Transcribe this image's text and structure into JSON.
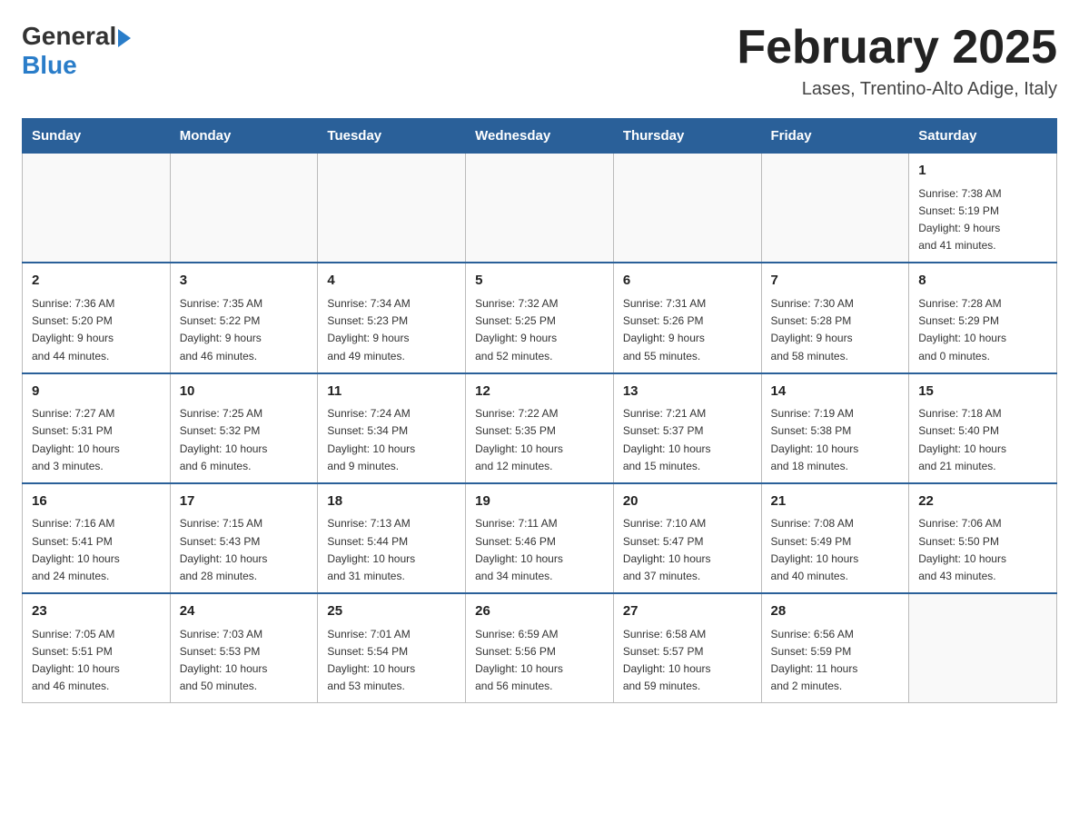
{
  "header": {
    "logo": {
      "general": "General",
      "blue": "Blue"
    },
    "title": "February 2025",
    "subtitle": "Lases, Trentino-Alto Adige, Italy"
  },
  "days_of_week": [
    "Sunday",
    "Monday",
    "Tuesday",
    "Wednesday",
    "Thursday",
    "Friday",
    "Saturday"
  ],
  "weeks": [
    {
      "days": [
        {
          "number": "",
          "info": ""
        },
        {
          "number": "",
          "info": ""
        },
        {
          "number": "",
          "info": ""
        },
        {
          "number": "",
          "info": ""
        },
        {
          "number": "",
          "info": ""
        },
        {
          "number": "",
          "info": ""
        },
        {
          "number": "1",
          "info": "Sunrise: 7:38 AM\nSunset: 5:19 PM\nDaylight: 9 hours\nand 41 minutes."
        }
      ]
    },
    {
      "days": [
        {
          "number": "2",
          "info": "Sunrise: 7:36 AM\nSunset: 5:20 PM\nDaylight: 9 hours\nand 44 minutes."
        },
        {
          "number": "3",
          "info": "Sunrise: 7:35 AM\nSunset: 5:22 PM\nDaylight: 9 hours\nand 46 minutes."
        },
        {
          "number": "4",
          "info": "Sunrise: 7:34 AM\nSunset: 5:23 PM\nDaylight: 9 hours\nand 49 minutes."
        },
        {
          "number": "5",
          "info": "Sunrise: 7:32 AM\nSunset: 5:25 PM\nDaylight: 9 hours\nand 52 minutes."
        },
        {
          "number": "6",
          "info": "Sunrise: 7:31 AM\nSunset: 5:26 PM\nDaylight: 9 hours\nand 55 minutes."
        },
        {
          "number": "7",
          "info": "Sunrise: 7:30 AM\nSunset: 5:28 PM\nDaylight: 9 hours\nand 58 minutes."
        },
        {
          "number": "8",
          "info": "Sunrise: 7:28 AM\nSunset: 5:29 PM\nDaylight: 10 hours\nand 0 minutes."
        }
      ]
    },
    {
      "days": [
        {
          "number": "9",
          "info": "Sunrise: 7:27 AM\nSunset: 5:31 PM\nDaylight: 10 hours\nand 3 minutes."
        },
        {
          "number": "10",
          "info": "Sunrise: 7:25 AM\nSunset: 5:32 PM\nDaylight: 10 hours\nand 6 minutes."
        },
        {
          "number": "11",
          "info": "Sunrise: 7:24 AM\nSunset: 5:34 PM\nDaylight: 10 hours\nand 9 minutes."
        },
        {
          "number": "12",
          "info": "Sunrise: 7:22 AM\nSunset: 5:35 PM\nDaylight: 10 hours\nand 12 minutes."
        },
        {
          "number": "13",
          "info": "Sunrise: 7:21 AM\nSunset: 5:37 PM\nDaylight: 10 hours\nand 15 minutes."
        },
        {
          "number": "14",
          "info": "Sunrise: 7:19 AM\nSunset: 5:38 PM\nDaylight: 10 hours\nand 18 minutes."
        },
        {
          "number": "15",
          "info": "Sunrise: 7:18 AM\nSunset: 5:40 PM\nDaylight: 10 hours\nand 21 minutes."
        }
      ]
    },
    {
      "days": [
        {
          "number": "16",
          "info": "Sunrise: 7:16 AM\nSunset: 5:41 PM\nDaylight: 10 hours\nand 24 minutes."
        },
        {
          "number": "17",
          "info": "Sunrise: 7:15 AM\nSunset: 5:43 PM\nDaylight: 10 hours\nand 28 minutes."
        },
        {
          "number": "18",
          "info": "Sunrise: 7:13 AM\nSunset: 5:44 PM\nDaylight: 10 hours\nand 31 minutes."
        },
        {
          "number": "19",
          "info": "Sunrise: 7:11 AM\nSunset: 5:46 PM\nDaylight: 10 hours\nand 34 minutes."
        },
        {
          "number": "20",
          "info": "Sunrise: 7:10 AM\nSunset: 5:47 PM\nDaylight: 10 hours\nand 37 minutes."
        },
        {
          "number": "21",
          "info": "Sunrise: 7:08 AM\nSunset: 5:49 PM\nDaylight: 10 hours\nand 40 minutes."
        },
        {
          "number": "22",
          "info": "Sunrise: 7:06 AM\nSunset: 5:50 PM\nDaylight: 10 hours\nand 43 minutes."
        }
      ]
    },
    {
      "days": [
        {
          "number": "23",
          "info": "Sunrise: 7:05 AM\nSunset: 5:51 PM\nDaylight: 10 hours\nand 46 minutes."
        },
        {
          "number": "24",
          "info": "Sunrise: 7:03 AM\nSunset: 5:53 PM\nDaylight: 10 hours\nand 50 minutes."
        },
        {
          "number": "25",
          "info": "Sunrise: 7:01 AM\nSunset: 5:54 PM\nDaylight: 10 hours\nand 53 minutes."
        },
        {
          "number": "26",
          "info": "Sunrise: 6:59 AM\nSunset: 5:56 PM\nDaylight: 10 hours\nand 56 minutes."
        },
        {
          "number": "27",
          "info": "Sunrise: 6:58 AM\nSunset: 5:57 PM\nDaylight: 10 hours\nand 59 minutes."
        },
        {
          "number": "28",
          "info": "Sunrise: 6:56 AM\nSunset: 5:59 PM\nDaylight: 11 hours\nand 2 minutes."
        },
        {
          "number": "",
          "info": ""
        }
      ]
    }
  ]
}
